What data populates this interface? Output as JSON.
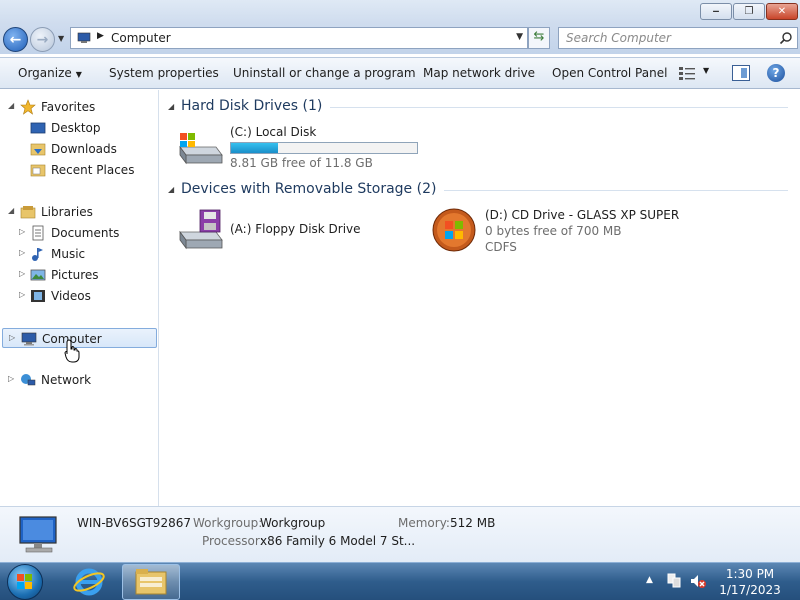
{
  "window": {
    "minimize_glyph": "‒",
    "maximize_glyph": "❐",
    "close_glyph": "✕"
  },
  "address": {
    "back_glyph": "←",
    "forward_glyph": "→",
    "separator": "▶",
    "path": "Computer",
    "dropdown": "▼",
    "refresh_glyph": "⇆",
    "search_placeholder": "Search Computer"
  },
  "toolbar": {
    "organize": "Organize",
    "system_properties": "System properties",
    "uninstall": "Uninstall or change a program",
    "map_network_drive": "Map network drive",
    "open_control_panel": "Open Control Panel",
    "caret": "▼",
    "help": "?"
  },
  "nav": {
    "expanded_tri": "◢",
    "collapsed_tri": "▷",
    "favorites": "Favorites",
    "desktop": "Desktop",
    "downloads": "Downloads",
    "recent_places": "Recent Places",
    "libraries": "Libraries",
    "documents": "Documents",
    "music": "Music",
    "pictures": "Pictures",
    "videos": "Videos",
    "computer": "Computer",
    "network": "Network"
  },
  "content": {
    "collapse_tri": "◢",
    "groups": [
      {
        "title": "Hard Disk Drives (1)",
        "drives": [
          {
            "name": "(C:) Local Disk",
            "free_text": "8.81 GB free of 11.8 GB",
            "used_fraction": 0.253
          }
        ]
      },
      {
        "title": "Devices with Removable Storage (2)",
        "drives": [
          {
            "name": "(A:) Floppy Disk Drive"
          },
          {
            "name": "(D:) CD Drive - GLASS XP SUPER",
            "free_text": "0 bytes free of 700 MB",
            "filesystem": "CDFS"
          }
        ]
      }
    ]
  },
  "details": {
    "computer_name": "WIN-BV6SGT92867",
    "workgroup_label": "Workgroup:",
    "workgroup_value": "Workgroup",
    "memory_label": "Memory:",
    "memory_value": "512 MB",
    "processor_label": "Processor:",
    "processor_value": "x86 Family 6 Model 7 St..."
  },
  "taskbar": {
    "tray_arrow": "▲",
    "time": "1:30 PM",
    "date": "1/17/2023"
  },
  "colors": {
    "accent": "#1f5fb8",
    "usage_fill": "#1a8ec9"
  }
}
